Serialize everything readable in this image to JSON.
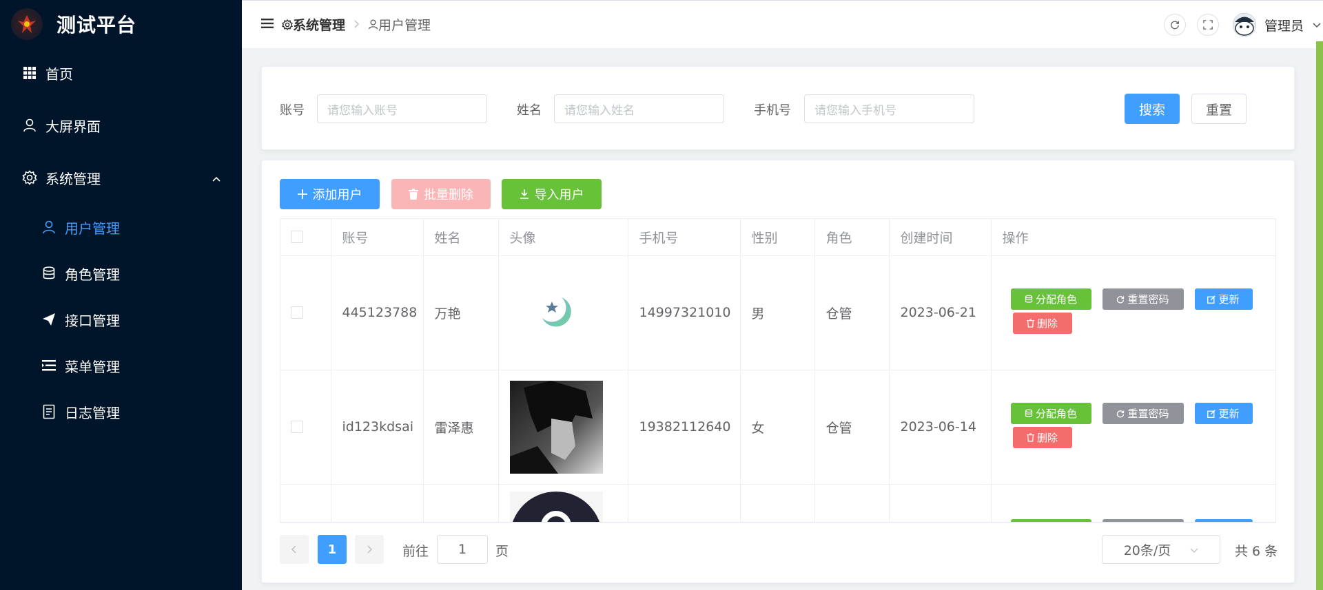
{
  "app": {
    "title": "测试平台"
  },
  "sidebar": {
    "items": [
      {
        "label": "首页",
        "icon": "grid-icon"
      },
      {
        "label": "大屏界面",
        "icon": "user-icon"
      },
      {
        "label": "系统管理",
        "icon": "gear-icon",
        "expanded": true
      },
      {
        "label": "用户管理",
        "icon": "user-icon",
        "active": true
      },
      {
        "label": "角色管理",
        "icon": "database-icon"
      },
      {
        "label": "接口管理",
        "icon": "send-icon"
      },
      {
        "label": "菜单管理",
        "icon": "list-icon"
      },
      {
        "label": "日志管理",
        "icon": "document-icon"
      }
    ]
  },
  "header": {
    "breadcrumb": [
      "系统管理",
      "用户管理"
    ],
    "username": "管理员"
  },
  "search": {
    "account_label": "账号",
    "account_placeholder": "请您输入账号",
    "name_label": "姓名",
    "name_placeholder": "请您输入姓名",
    "phone_label": "手机号",
    "phone_placeholder": "请您输入手机号",
    "search_button": "搜索",
    "reset_button": "重置"
  },
  "toolbar": {
    "add_label": "添加用户",
    "batch_delete_label": "批量删除",
    "import_label": "导入用户"
  },
  "table": {
    "columns": [
      "账号",
      "姓名",
      "头像",
      "手机号",
      "性别",
      "角色",
      "创建时间",
      "操作"
    ],
    "rows": [
      {
        "account": "445123788",
        "name": "万艳",
        "avatar": "moon-star-avatar",
        "phone": "14997321010",
        "gender": "男",
        "role": "仓管",
        "created": "2023-06-21"
      },
      {
        "account": "id123kdsai",
        "name": "雷泽惠",
        "avatar": "anime-avatar",
        "phone": "19382112640",
        "gender": "女",
        "role": "仓管",
        "created": "2023-06-14"
      },
      {
        "account": "",
        "name": "",
        "avatar": "dark-circle-avatar",
        "phone": "",
        "gender": "",
        "role": "",
        "created": ""
      }
    ],
    "actions": {
      "assign_role": "分配角色",
      "reset_password": "重置密码",
      "update": "更新",
      "delete": "删除"
    }
  },
  "pagination": {
    "current_page": "1",
    "goto_prefix": "前往",
    "goto_value": "1",
    "goto_suffix": "页",
    "page_size": "20条/页",
    "total": "共 6 条"
  },
  "colors": {
    "sidebar_bg": "#001529",
    "primary": "#409eff",
    "success": "#67c23a",
    "info": "#909399",
    "danger": "#f56c6c",
    "danger_light": "#fab6b6"
  }
}
